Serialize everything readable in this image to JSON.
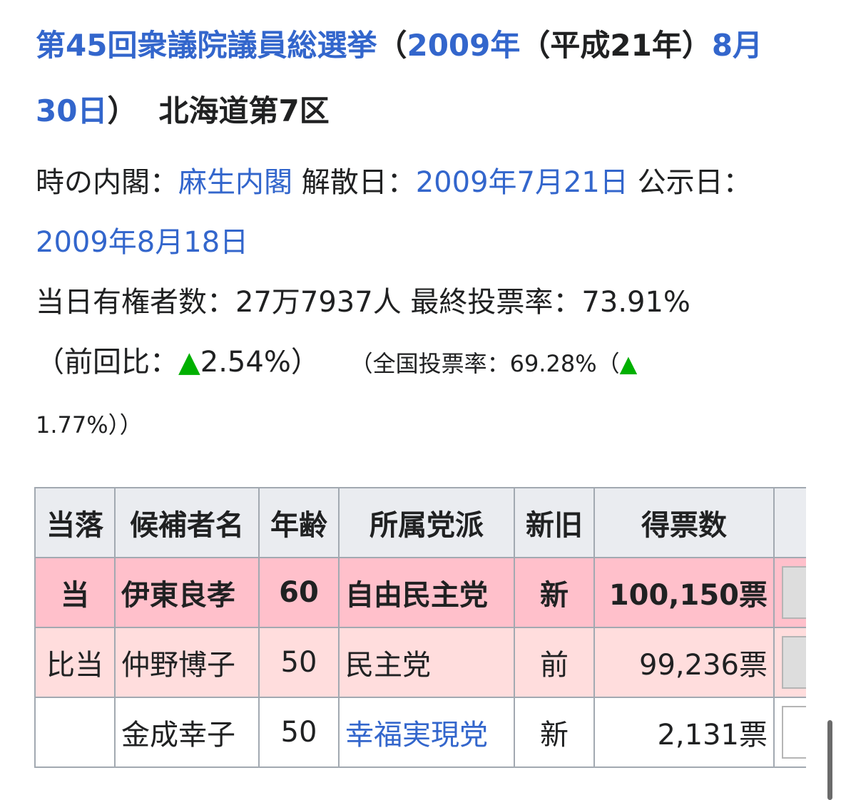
{
  "heading": {
    "election_link": "第45回衆議院議員総選挙",
    "paren_open": "（",
    "year_link": "2009年",
    "era_text": "（平成21年）",
    "date_link": "8月30日",
    "paren_close": "）",
    "district": "北海道第7区"
  },
  "info": {
    "cabinet_label": "時の内閣：",
    "cabinet_link": "麻生内閣",
    "dissolution_label": "解散日：",
    "dissolution_link": "2009年7月21日",
    "announcement_label": "公示日：",
    "announcement_link": "2009年8月18日",
    "voters_label": "当日有権者数：",
    "voters_value": "27万7937人",
    "turnout_label": "最終投票率：",
    "turnout_value": "73.91%",
    "prev_open": "（前回比：",
    "prev_triangle": "▲",
    "prev_value": "2.54%）",
    "national_open": "（全国投票率：",
    "national_value": "69.28%（",
    "national_triangle": "▲",
    "national_diff": "1.77%））"
  },
  "table": {
    "headers": [
      "当落",
      "候補者名",
      "年齢",
      "所属党派",
      "新旧",
      "得票数"
    ],
    "rows": [
      {
        "result": "当",
        "name": "伊東良孝",
        "age": "60",
        "party": "自由民主党",
        "newold": "新",
        "votes": "100,150票"
      },
      {
        "result": "比当",
        "name": "仲野博子",
        "age": "50",
        "party": "民主党",
        "newold": "前",
        "votes": "99,236票"
      },
      {
        "result": "",
        "name": "金成幸子",
        "age": "50",
        "party": "幸福実現党",
        "newold": "新",
        "votes": "2,131票"
      }
    ]
  },
  "colors": {
    "link": "#3366cc",
    "winner_row": "#ffc0cb",
    "proportional_row": "#ffdddd",
    "header_bg": "#eaecf0",
    "up_triangle": "#00b000"
  }
}
